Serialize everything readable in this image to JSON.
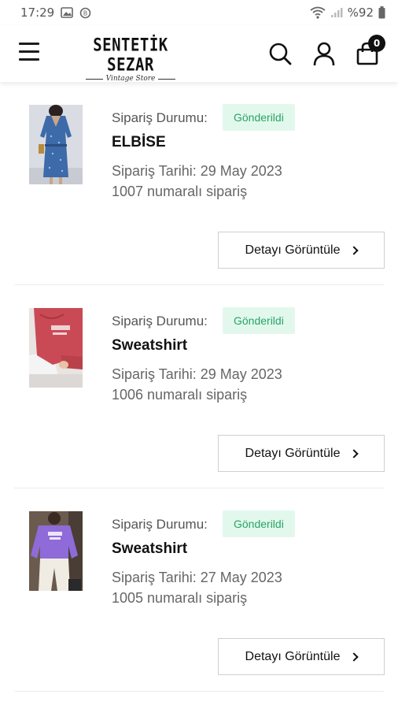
{
  "status_bar": {
    "time": "17:29",
    "battery": "%92"
  },
  "brand": {
    "name": "SENTETİK SEZAR",
    "tagline": "Vintage Store"
  },
  "cart": {
    "count": "0"
  },
  "orders": [
    {
      "status_label": "Sipariş Durumu:",
      "status": "Gönderildi",
      "product": "ELBİSE",
      "date": "Sipariş Tarihi: 29 May 2023",
      "number": "1007 numaralı sipariş",
      "button": "Detayı Görüntüle"
    },
    {
      "status_label": "Sipariş Durumu:",
      "status": "Gönderildi",
      "product": "Sweatshirt",
      "date": "Sipariş Tarihi: 29 May 2023",
      "number": "1006 numaralı sipariş",
      "button": "Detayı Görüntüle"
    },
    {
      "status_label": "Sipariş Durumu:",
      "status": "Gönderildi",
      "product": "Sweatshirt",
      "date": "Sipariş Tarihi: 27 May 2023",
      "number": "1005 numaralı sipariş",
      "button": "Detayı Görüntüle"
    }
  ],
  "colors": {
    "status_bg": "#e3f8ec",
    "status_text": "#25a566",
    "accent": "#111111"
  }
}
